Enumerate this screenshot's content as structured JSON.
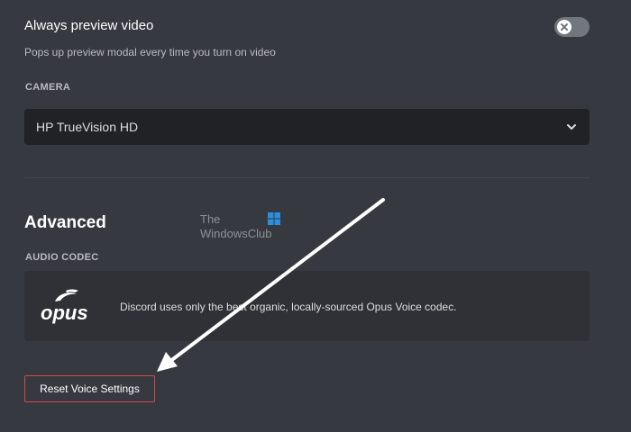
{
  "video_preview": {
    "title": "Always preview video",
    "description": "Pops up preview modal every time you turn on video",
    "toggle_state": "off"
  },
  "camera": {
    "label": "CAMERA",
    "selected": "HP TrueVision HD",
    "icon": "chevron-down-icon"
  },
  "advanced": {
    "title": "Advanced"
  },
  "watermark": {
    "line1": "The",
    "line2": "WindowsClub"
  },
  "audio_codec": {
    "label": "AUDIO CODEC",
    "logo_text": "opus",
    "description": "Discord uses only the best organic, locally-sourced Opus Voice codec."
  },
  "reset_button": {
    "label": "Reset Voice Settings"
  },
  "colors": {
    "background": "#36393f",
    "input_bg": "#202225",
    "card_bg": "#2f3136",
    "danger_border": "#d04a4a",
    "toggle_off": "#72767d"
  }
}
